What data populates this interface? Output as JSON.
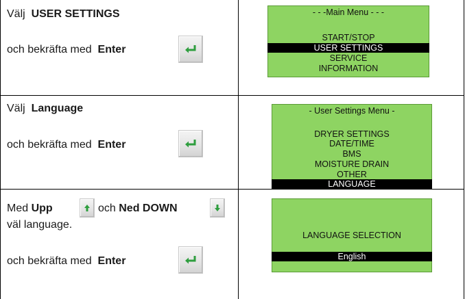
{
  "rows": [
    {
      "instruction_prefix": "Välj",
      "instruction_target": "USER SETTINGS",
      "confirm_prefix": "och bekräfta med",
      "confirm_key": "Enter",
      "screen": {
        "title": "- - -Main Menu - - -",
        "items": [
          "START/STOP",
          "USER SETTINGS",
          "SERVICE",
          "INFORMATION"
        ],
        "selected": "USER SETTINGS"
      }
    },
    {
      "instruction_prefix": "Välj",
      "instruction_target": "Language",
      "confirm_prefix": "och bekräfta med",
      "confirm_key": "Enter",
      "screen": {
        "title": "- User Settings Menu -",
        "items": [
          "DRYER SETTINGS",
          "DATE/TIME",
          "BMS",
          "MOISTURE DRAIN",
          "OTHER",
          "LANGUAGE"
        ],
        "selected": "LANGUAGE"
      }
    },
    {
      "med": "Med",
      "upp": "Upp",
      "och": "och",
      "ned": "Ned DOWN",
      "choose_text": "väl language.",
      "confirm_prefix": "och bekräfta med",
      "confirm_key": "Enter",
      "screen": {
        "heading": "LANGUAGE SELECTION",
        "selected": "English"
      }
    }
  ],
  "icons": {
    "enter": "enter-key-icon",
    "up": "up-arrow-key-icon",
    "down": "down-arrow-key-icon"
  },
  "colors": {
    "lcd_background": "#8ed462",
    "highlight": "#000000",
    "key_arrow": "#2e9e3e"
  }
}
